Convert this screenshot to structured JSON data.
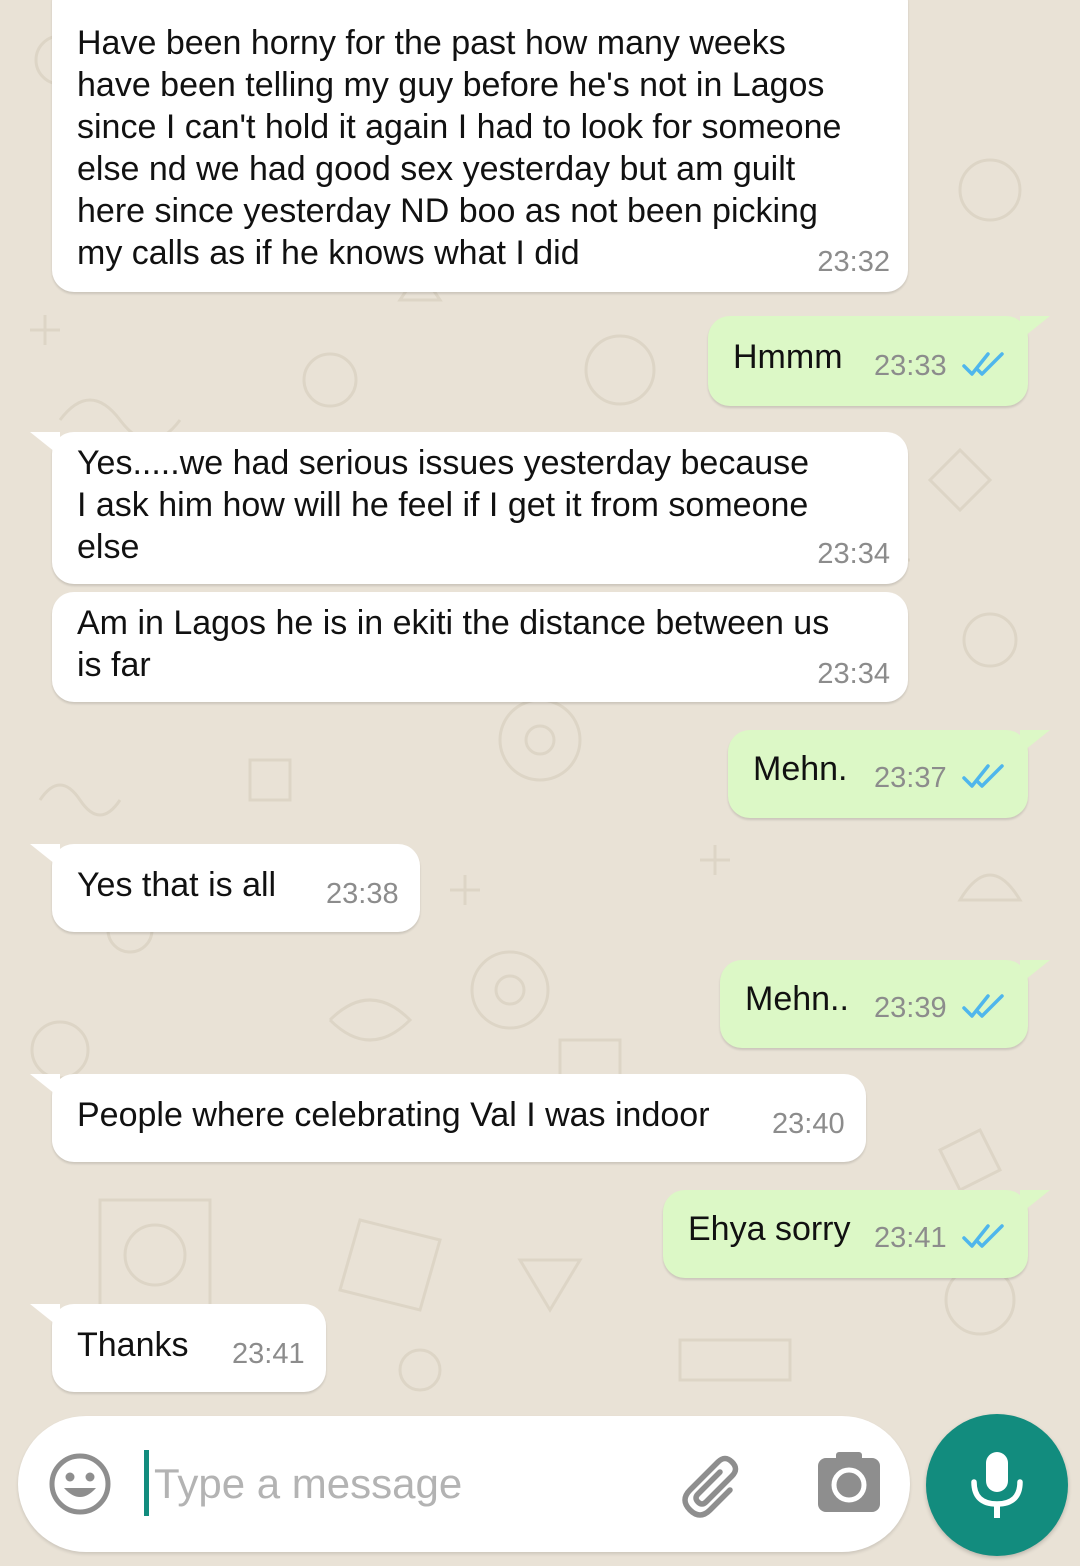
{
  "messages": [
    {
      "direction": "incoming",
      "text": "Have been horny for the past how many weeks\nhave been telling my guy before he's not in Lagos\nsince I can't hold it again I had to look for someone\nelse nd we had good sex yesterday but am guilt\nhere since yesterday ND boo as not been picking\nmy calls as if he knows what I did",
      "time": "23:32"
    },
    {
      "direction": "outgoing",
      "text": "Hmmm",
      "time": "23:33",
      "status": "read"
    },
    {
      "direction": "incoming",
      "text": "Yes.....we had serious issues yesterday because\nI ask him how will he feel if I get it from someone\nelse",
      "time": "23:34"
    },
    {
      "direction": "incoming",
      "text": "Am in Lagos he is in ekiti the distance between us\nis far",
      "time": "23:34"
    },
    {
      "direction": "outgoing",
      "text": "Mehn.",
      "time": "23:37",
      "status": "read"
    },
    {
      "direction": "incoming",
      "text": "Yes that is all",
      "time": "23:38"
    },
    {
      "direction": "outgoing",
      "text": "Mehn..",
      "time": "23:39",
      "status": "read"
    },
    {
      "direction": "incoming",
      "text": "People where celebrating Val I was indoor",
      "time": "23:40"
    },
    {
      "direction": "outgoing",
      "text": "Ehya sorry",
      "time": "23:41",
      "status": "read"
    },
    {
      "direction": "incoming",
      "text": "Thanks",
      "time": "23:41"
    }
  ],
  "composer": {
    "placeholder": "Type a message",
    "emoji_icon": "emoji-icon",
    "attach_icon": "paperclip-icon",
    "camera_icon": "camera-icon",
    "send_icon": "microphone-icon"
  },
  "colors": {
    "wallpaper": "#e9e2d6",
    "incoming_bubble": "#ffffff",
    "outgoing_bubble": "#dcf8c6",
    "read_ticks": "#4fb6ec",
    "accent": "#128c7e",
    "timestamp": "#8c8c8c"
  }
}
